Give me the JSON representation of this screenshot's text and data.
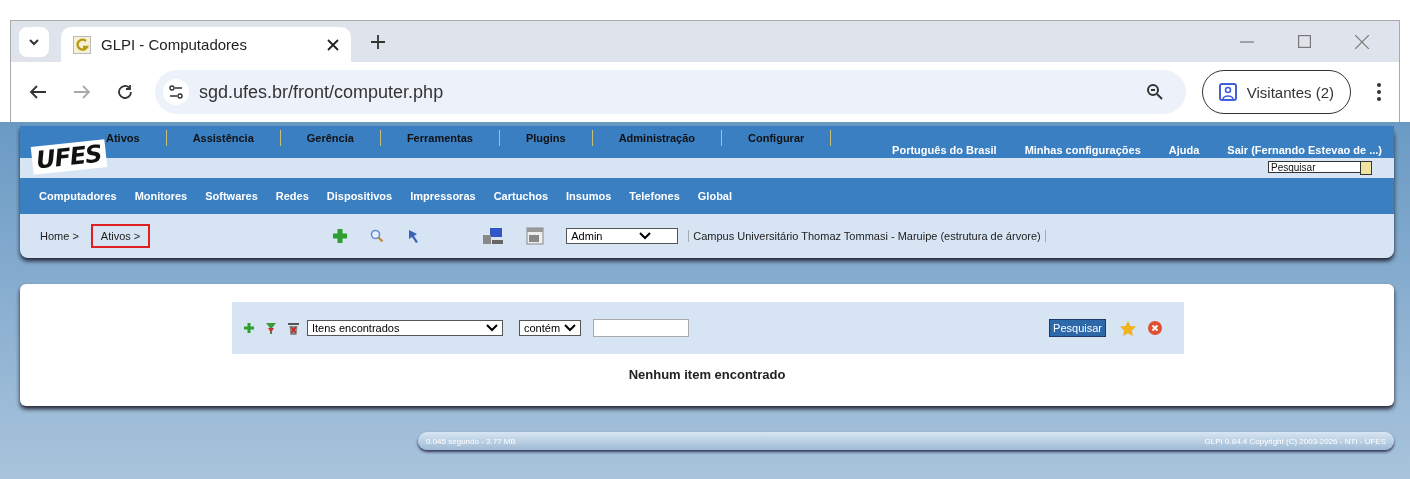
{
  "browser": {
    "tab_title": "GLPI - Computadores",
    "url": "sgd.ufes.br/front/computer.php",
    "profile": "Visitantes (2)"
  },
  "header": {
    "logo": "UFES",
    "main_menu": [
      "Ativos",
      "Assistência",
      "Gerência",
      "Ferramentas",
      "Plugins",
      "Administração",
      "Configurar"
    ],
    "user_links": [
      "Português do Brasil",
      "Minhas configurações",
      "Ajuda",
      "Sair (Fernando Estevao de ...)"
    ],
    "search": {
      "placeholder": "Pesquisar"
    },
    "sub_menu": [
      "Computadores",
      "Monitores",
      "Softwares",
      "Redes",
      "Dispositivos",
      "Impressoras",
      "Cartuchos",
      "Insumos",
      "Telefones",
      "Global"
    ],
    "breadcrumbs": [
      {
        "label": "Home >",
        "highlighted": false
      },
      {
        "label": "Ativos >",
        "highlighted": true
      }
    ],
    "profile_select": "Admin",
    "entity": "Campus Universitário Thomaz Tommasi - Maruipe (estrutura de árvore)"
  },
  "search_form": {
    "field_select": "Itens encontrados",
    "operator_select": "contém",
    "button": "Pesquisar"
  },
  "message": "Nenhum item encontrado",
  "footer": {
    "left": "0.045 segundo - 3.77 MB",
    "right": "GLPI 0.84.4 Copyright (C) 2003-2026 - NTI - UFES"
  }
}
